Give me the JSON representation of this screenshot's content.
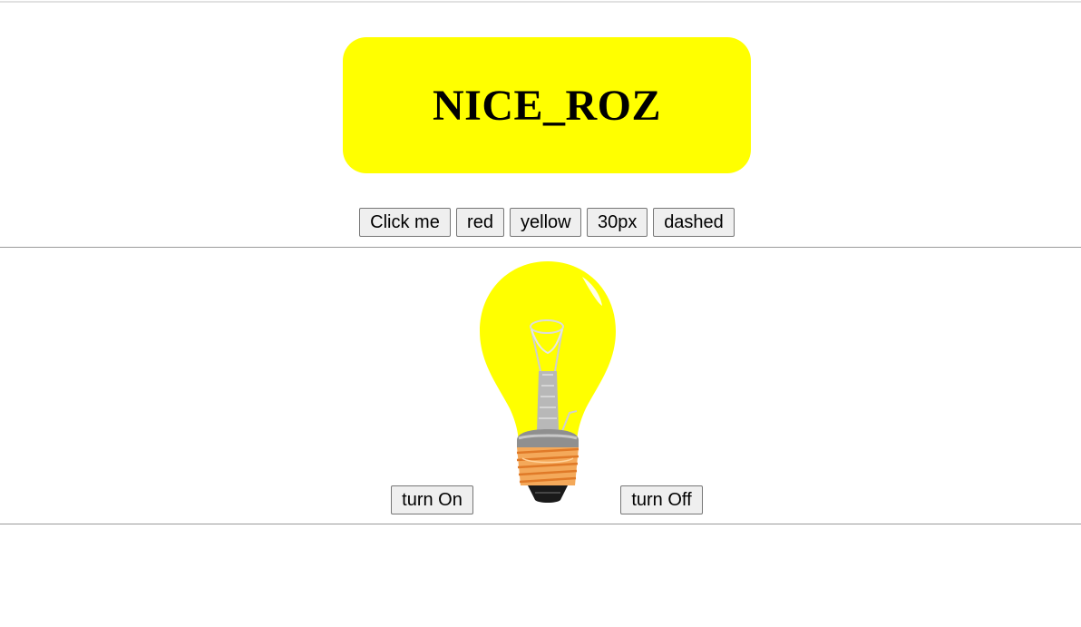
{
  "header": {
    "title": "NICE_ROZ"
  },
  "controls": {
    "click_me_label": "Click me",
    "red_label": "red",
    "yellow_label": "yellow",
    "size_label": "30px",
    "dashed_label": "dashed"
  },
  "lamp": {
    "turn_on_label": "turn On",
    "turn_off_label": "turn Off",
    "state": "on"
  },
  "colors": {
    "title_background": "#ffff00",
    "bulb_glass": "#ffff00",
    "bulb_base": "#f4a95a"
  }
}
